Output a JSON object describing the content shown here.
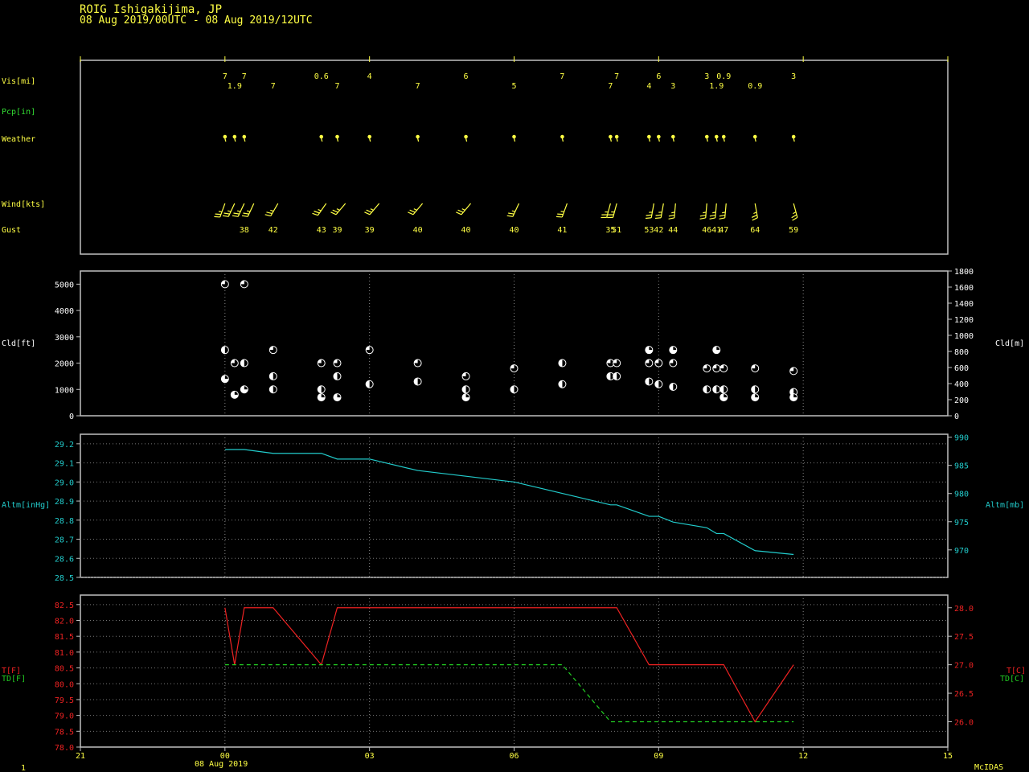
{
  "header": {
    "station": "ROIG  Ishigakijima,  JP",
    "period": "08 Aug 2019/00UTC - 08 Aug 2019/12UTC"
  },
  "footer": {
    "page": "1",
    "date": "08 Aug 2019",
    "brand": "McIDAS"
  },
  "colors": {
    "text": "#ffff44",
    "axis": "#c0c0c0",
    "precip": "#33dd33",
    "altimeter": "#22cccc",
    "temperature": "#ee2222",
    "dewpoint": "#22cc22"
  },
  "labels": {
    "vis": "Vis[mi]",
    "pcp": "Pcp[in]",
    "weather": "Weather",
    "wind": "Wind[kts]",
    "gust": "Gust",
    "cld_left": "Cld[ft]",
    "cld_right": "Cld[m]",
    "altm_left": "Altm[inHg]",
    "altm_right": "Altm[mb]",
    "t_left": "T[F]",
    "td_left": "TD[F]",
    "t_right": "T[C]",
    "td_right": "TD[C]"
  },
  "chart_data": {
    "type": "line",
    "x_axis": {
      "unit": "hours from 08 Aug 2019 00UTC",
      "range": [
        -3,
        15
      ],
      "ticks": [
        -3,
        0,
        3,
        6,
        9,
        12,
        15
      ],
      "tick_labels": [
        "21",
        "00",
        "03",
        "06",
        "09",
        "12",
        "15"
      ]
    },
    "visibility": [
      {
        "x": 0.0,
        "label": "7",
        "row": 0
      },
      {
        "x": 0.2,
        "label": "1.9",
        "row": 1
      },
      {
        "x": 0.4,
        "label": "7",
        "row": 0
      },
      {
        "x": 1.0,
        "label": "7",
        "row": 1
      },
      {
        "x": 2.0,
        "label": "0.6",
        "row": 0
      },
      {
        "x": 2.33,
        "label": "7",
        "row": 1
      },
      {
        "x": 3.0,
        "label": "4",
        "row": 0
      },
      {
        "x": 4.0,
        "label": "7",
        "row": 1
      },
      {
        "x": 5.0,
        "label": "6",
        "row": 0
      },
      {
        "x": 6.0,
        "label": "5",
        "row": 1
      },
      {
        "x": 7.0,
        "label": "7",
        "row": 0
      },
      {
        "x": 8.0,
        "label": "7",
        "row": 1
      },
      {
        "x": 8.13,
        "label": "7",
        "row": 0
      },
      {
        "x": 8.8,
        "label": "4",
        "row": 1
      },
      {
        "x": 9.0,
        "label": "6",
        "row": 0
      },
      {
        "x": 9.3,
        "label": "3",
        "row": 1
      },
      {
        "x": 10.0,
        "label": "3",
        "row": 0
      },
      {
        "x": 10.2,
        "label": "1.9",
        "row": 1
      },
      {
        "x": 10.35,
        "label": "0.9",
        "row": 0
      },
      {
        "x": 11.0,
        "label": "0.9",
        "row": 1
      },
      {
        "x": 11.8,
        "label": "3",
        "row": 0
      }
    ],
    "weather_x": [
      0.0,
      0.2,
      0.4,
      2.0,
      2.33,
      3.0,
      4.0,
      5.0,
      6.0,
      7.0,
      8.0,
      8.13,
      8.8,
      9.0,
      9.3,
      10.0,
      10.2,
      10.35,
      11.0,
      11.8
    ],
    "wind": [
      {
        "x": 0.0,
        "dir": 200,
        "spd": 25
      },
      {
        "x": 0.2,
        "dir": 205,
        "spd": 25
      },
      {
        "x": 0.4,
        "dir": 205,
        "spd": 25
      },
      {
        "x": 0.6,
        "dir": 205,
        "spd": 25
      },
      {
        "x": 1.1,
        "dir": 210,
        "spd": 25
      },
      {
        "x": 2.1,
        "dir": 215,
        "spd": 25
      },
      {
        "x": 2.5,
        "dir": 220,
        "spd": 25
      },
      {
        "x": 3.2,
        "dir": 220,
        "spd": 25
      },
      {
        "x": 4.1,
        "dir": 220,
        "spd": 25
      },
      {
        "x": 5.1,
        "dir": 220,
        "spd": 25
      },
      {
        "x": 6.1,
        "dir": 205,
        "spd": 25
      },
      {
        "x": 7.1,
        "dir": 200,
        "spd": 25
      },
      {
        "x": 8.0,
        "dir": 195,
        "spd": 25
      },
      {
        "x": 8.13,
        "dir": 195,
        "spd": 25
      },
      {
        "x": 8.9,
        "dir": 190,
        "spd": 25
      },
      {
        "x": 9.1,
        "dir": 190,
        "spd": 25
      },
      {
        "x": 9.35,
        "dir": 185,
        "spd": 25
      },
      {
        "x": 10.0,
        "dir": 185,
        "spd": 25
      },
      {
        "x": 10.2,
        "dir": 185,
        "spd": 25
      },
      {
        "x": 10.4,
        "dir": 185,
        "spd": 25
      },
      {
        "x": 11.0,
        "dir": 170,
        "spd": 25
      },
      {
        "x": 11.8,
        "dir": 165,
        "spd": 25
      }
    ],
    "gust": [
      {
        "x": 0.4,
        "label": "38"
      },
      {
        "x": 1.0,
        "label": "42"
      },
      {
        "x": 2.0,
        "label": "43"
      },
      {
        "x": 2.33,
        "label": "39"
      },
      {
        "x": 3.0,
        "label": "39"
      },
      {
        "x": 4.0,
        "label": "40"
      },
      {
        "x": 5.0,
        "label": "40"
      },
      {
        "x": 6.0,
        "label": "40"
      },
      {
        "x": 7.0,
        "label": "41"
      },
      {
        "x": 8.0,
        "label": "35"
      },
      {
        "x": 8.13,
        "label": "51"
      },
      {
        "x": 8.8,
        "label": "53"
      },
      {
        "x": 9.0,
        "label": "42"
      },
      {
        "x": 9.3,
        "label": "44"
      },
      {
        "x": 10.0,
        "label": "46"
      },
      {
        "x": 10.2,
        "label": "41"
      },
      {
        "x": 10.35,
        "label": "47"
      },
      {
        "x": 11.0,
        "label": "64"
      },
      {
        "x": 11.8,
        "label": "59"
      }
    ],
    "cloud": {
      "ylim_ft": [
        0,
        5500
      ],
      "ticks_ft": [
        0,
        1000,
        2000,
        3000,
        4000,
        5000
      ],
      "ylim_m": [
        0,
        1800
      ],
      "ticks_m": [
        0,
        200,
        400,
        600,
        800,
        1000,
        1200,
        1400,
        1600,
        1800
      ],
      "layers": [
        {
          "x": 0.0,
          "ft": 5000,
          "cover": "BKN"
        },
        {
          "x": 0.0,
          "ft": 2500,
          "cover": "SCT"
        },
        {
          "x": 0.0,
          "ft": 1400,
          "cover": "FEW"
        },
        {
          "x": 0.2,
          "ft": 2000,
          "cover": "BKN"
        },
        {
          "x": 0.2,
          "ft": 800,
          "cover": "FEW"
        },
        {
          "x": 0.4,
          "ft": 5000,
          "cover": "BKN"
        },
        {
          "x": 0.4,
          "ft": 2000,
          "cover": "SCT"
        },
        {
          "x": 0.4,
          "ft": 1000,
          "cover": "FEW"
        },
        {
          "x": 1.0,
          "ft": 2500,
          "cover": "BKN"
        },
        {
          "x": 1.0,
          "ft": 1500,
          "cover": "SCT"
        },
        {
          "x": 1.0,
          "ft": 1000,
          "cover": "SCT"
        },
        {
          "x": 2.0,
          "ft": 2000,
          "cover": "BKN"
        },
        {
          "x": 2.0,
          "ft": 1000,
          "cover": "SCT"
        },
        {
          "x": 2.0,
          "ft": 700,
          "cover": "FEW"
        },
        {
          "x": 2.33,
          "ft": 2000,
          "cover": "BKN"
        },
        {
          "x": 2.33,
          "ft": 1500,
          "cover": "SCT"
        },
        {
          "x": 2.33,
          "ft": 700,
          "cover": "FEW"
        },
        {
          "x": 3.0,
          "ft": 2500,
          "cover": "BKN"
        },
        {
          "x": 3.0,
          "ft": 1200,
          "cover": "SCT"
        },
        {
          "x": 4.0,
          "ft": 2000,
          "cover": "BKN"
        },
        {
          "x": 4.0,
          "ft": 1300,
          "cover": "SCT"
        },
        {
          "x": 5.0,
          "ft": 1500,
          "cover": "BKN"
        },
        {
          "x": 5.0,
          "ft": 1000,
          "cover": "SCT"
        },
        {
          "x": 5.0,
          "ft": 700,
          "cover": "FEW"
        },
        {
          "x": 6.0,
          "ft": 1800,
          "cover": "BKN"
        },
        {
          "x": 6.0,
          "ft": 1000,
          "cover": "SCT"
        },
        {
          "x": 7.0,
          "ft": 2000,
          "cover": "SCT"
        },
        {
          "x": 7.0,
          "ft": 1200,
          "cover": "SCT"
        },
        {
          "x": 8.0,
          "ft": 2000,
          "cover": "BKN"
        },
        {
          "x": 8.0,
          "ft": 1500,
          "cover": "SCT"
        },
        {
          "x": 8.13,
          "ft": 2000,
          "cover": "BKN"
        },
        {
          "x": 8.13,
          "ft": 1500,
          "cover": "SCT"
        },
        {
          "x": 8.8,
          "ft": 2500,
          "cover": "FEW"
        },
        {
          "x": 8.8,
          "ft": 2000,
          "cover": "BKN"
        },
        {
          "x": 8.8,
          "ft": 1300,
          "cover": "SCT"
        },
        {
          "x": 9.0,
          "ft": 2000,
          "cover": "BKN"
        },
        {
          "x": 9.0,
          "ft": 1200,
          "cover": "SCT"
        },
        {
          "x": 9.3,
          "ft": 2500,
          "cover": "FEW"
        },
        {
          "x": 9.3,
          "ft": 2000,
          "cover": "BKN"
        },
        {
          "x": 9.3,
          "ft": 1100,
          "cover": "SCT"
        },
        {
          "x": 10.0,
          "ft": 1800,
          "cover": "BKN"
        },
        {
          "x": 10.0,
          "ft": 1000,
          "cover": "SCT"
        },
        {
          "x": 10.2,
          "ft": 2500,
          "cover": "FEW"
        },
        {
          "x": 10.2,
          "ft": 1800,
          "cover": "BKN"
        },
        {
          "x": 10.2,
          "ft": 1000,
          "cover": "SCT"
        },
        {
          "x": 10.35,
          "ft": 1800,
          "cover": "BKN"
        },
        {
          "x": 10.35,
          "ft": 1000,
          "cover": "SCT"
        },
        {
          "x": 10.35,
          "ft": 700,
          "cover": "FEW"
        },
        {
          "x": 11.0,
          "ft": 1800,
          "cover": "BKN"
        },
        {
          "x": 11.0,
          "ft": 1000,
          "cover": "SCT"
        },
        {
          "x": 11.0,
          "ft": 700,
          "cover": "FEW"
        },
        {
          "x": 11.8,
          "ft": 1700,
          "cover": "BKN"
        },
        {
          "x": 11.8,
          "ft": 900,
          "cover": "SCT"
        },
        {
          "x": 11.8,
          "ft": 700,
          "cover": "FEW"
        }
      ]
    },
    "altimeter": {
      "ylim_inhg": [
        28.5,
        29.25
      ],
      "ticks_inhg": [
        "28.5",
        "28.6",
        "28.7",
        "28.8",
        "28.9",
        "29.0",
        "29.1",
        "29.2"
      ],
      "ticks_mb": [
        970,
        975,
        980,
        985,
        990
      ],
      "series": [
        {
          "x": 0.0,
          "y": 29.17
        },
        {
          "x": 0.4,
          "y": 29.17
        },
        {
          "x": 1.0,
          "y": 29.15
        },
        {
          "x": 2.0,
          "y": 29.15
        },
        {
          "x": 2.33,
          "y": 29.12
        },
        {
          "x": 3.0,
          "y": 29.12
        },
        {
          "x": 4.0,
          "y": 29.06
        },
        {
          "x": 5.0,
          "y": 29.03
        },
        {
          "x": 6.0,
          "y": 29.0
        },
        {
          "x": 7.0,
          "y": 28.94
        },
        {
          "x": 8.0,
          "y": 28.88
        },
        {
          "x": 8.13,
          "y": 28.88
        },
        {
          "x": 8.8,
          "y": 28.82
        },
        {
          "x": 9.0,
          "y": 28.82
        },
        {
          "x": 9.3,
          "y": 28.79
        },
        {
          "x": 10.0,
          "y": 28.76
        },
        {
          "x": 10.2,
          "y": 28.73
        },
        {
          "x": 10.35,
          "y": 28.73
        },
        {
          "x": 11.0,
          "y": 28.64
        },
        {
          "x": 11.8,
          "y": 28.62
        }
      ]
    },
    "temperature": {
      "ylim_f": [
        78.0,
        82.8
      ],
      "ticks_f": [
        "78.0",
        "78.5",
        "79.0",
        "79.5",
        "80.0",
        "80.5",
        "81.0",
        "81.5",
        "82.0",
        "82.5"
      ],
      "ticks_c": [
        "26.0",
        "26.5",
        "27.0",
        "27.5",
        "28.0"
      ],
      "series": [
        {
          "name": "T",
          "points": [
            {
              "x": 0.0,
              "y": 82.4
            },
            {
              "x": 0.2,
              "y": 80.6
            },
            {
              "x": 0.4,
              "y": 82.4
            },
            {
              "x": 1.0,
              "y": 82.4
            },
            {
              "x": 2.0,
              "y": 80.6
            },
            {
              "x": 2.33,
              "y": 82.4
            },
            {
              "x": 8.13,
              "y": 82.4
            },
            {
              "x": 8.8,
              "y": 80.6
            },
            {
              "x": 10.35,
              "y": 80.6
            },
            {
              "x": 11.0,
              "y": 78.8
            },
            {
              "x": 11.8,
              "y": 80.6
            }
          ]
        },
        {
          "name": "TD",
          "points": [
            {
              "x": 0.0,
              "y": 80.6
            },
            {
              "x": 7.0,
              "y": 80.6
            },
            {
              "x": 8.0,
              "y": 78.8
            },
            {
              "x": 11.8,
              "y": 78.8
            }
          ]
        }
      ]
    }
  }
}
